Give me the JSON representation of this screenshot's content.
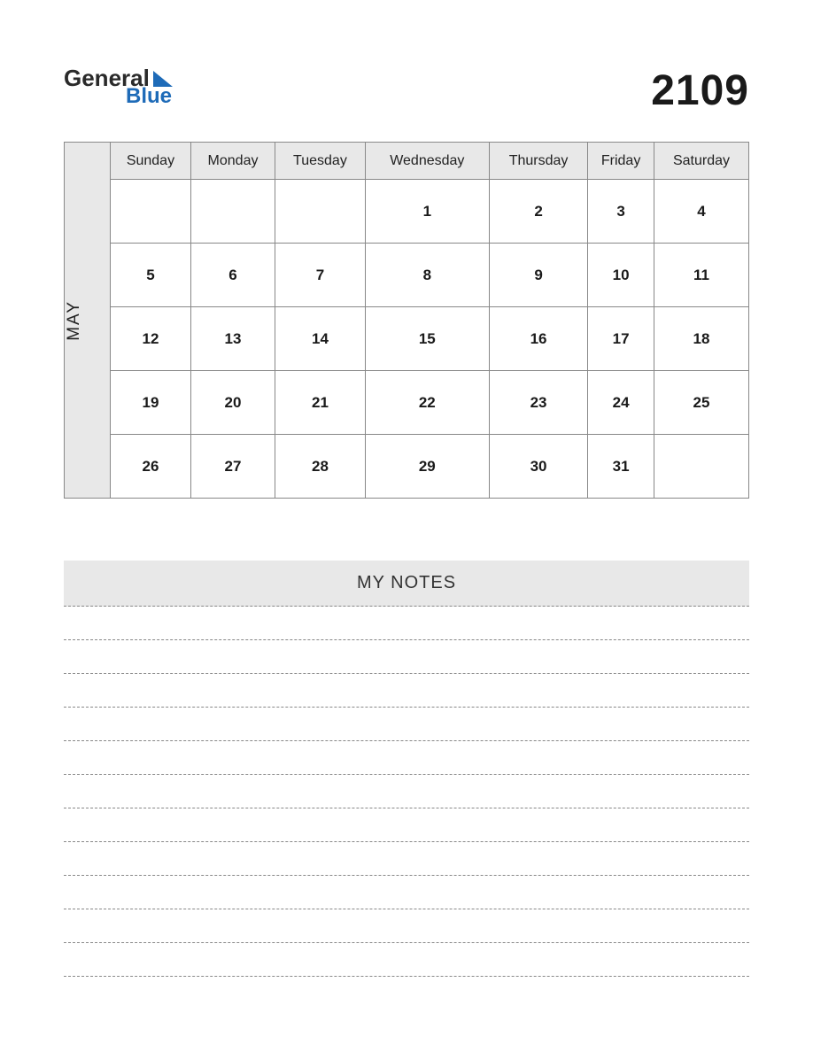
{
  "logo": {
    "word1": "General",
    "word2": "Blue"
  },
  "year": "2109",
  "month": "MAY",
  "day_headers": [
    "Sunday",
    "Monday",
    "Tuesday",
    "Wednesday",
    "Thursday",
    "Friday",
    "Saturday"
  ],
  "weeks": [
    [
      "",
      "",
      "",
      "1",
      "2",
      "3",
      "4"
    ],
    [
      "5",
      "6",
      "7",
      "8",
      "9",
      "10",
      "11"
    ],
    [
      "12",
      "13",
      "14",
      "15",
      "16",
      "17",
      "18"
    ],
    [
      "19",
      "20",
      "21",
      "22",
      "23",
      "24",
      "25"
    ],
    [
      "26",
      "27",
      "28",
      "29",
      "30",
      "31",
      ""
    ]
  ],
  "notes_title": "MY NOTES",
  "note_lines_count": 11
}
